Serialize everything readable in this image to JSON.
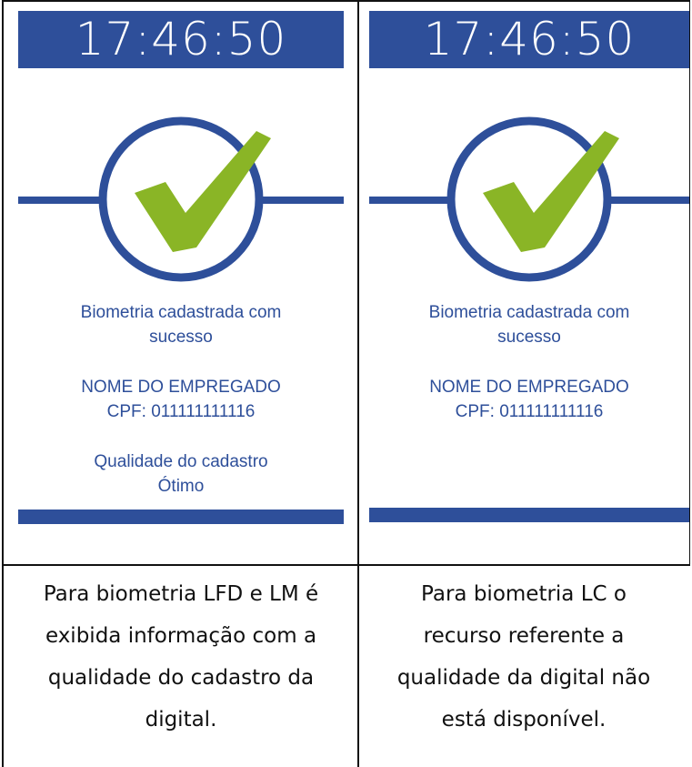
{
  "panels": [
    {
      "clock": "17:46:50",
      "success_lines": [
        "Biometria cadastrada com",
        "sucesso"
      ],
      "employee_name": "NOME DO EMPREGADO",
      "employee_cpf": "CPF: 011111111116",
      "quality_label": "Qualidade do cadastro",
      "quality_value": "Ótimo",
      "icon": "check-circle-icon",
      "caption_lines": [
        "Para biometria LFD e LM é",
        "exibida informação com a",
        "qualidade do cadastro da",
        "digital."
      ]
    },
    {
      "clock": "17:46:50",
      "success_lines": [
        "Biometria cadastrada com",
        "sucesso"
      ],
      "employee_name": "NOME DO EMPREGADO",
      "employee_cpf": "CPF: 011111111116",
      "icon": "check-circle-icon",
      "caption_lines": [
        "Para biometria LC o",
        "recurso referente a",
        "qualidade da digital não",
        "está disponível."
      ]
    }
  ],
  "colors": {
    "accent_blue": "#2e4f9a",
    "check_green": "#8ab526",
    "border": "#111111"
  }
}
